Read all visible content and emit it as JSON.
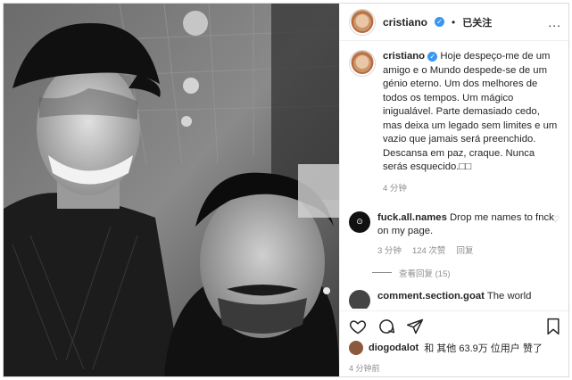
{
  "header": {
    "username": "cristiano",
    "verified_icon": "verified-badge-icon",
    "separator": "•",
    "follow_label": "已关注",
    "more_label": "..."
  },
  "caption": {
    "username": "cristiano",
    "text": "Hoje despeço-me de um amigo e o Mundo despede-se de um génio eterno. Um dos melhores de todos os tempos. Um mágico inigualável. Parte demasiado cedo, mas deixa um legado sem limites e um vazio que jamais será preenchido. Descansa em paz, craque. Nunca serás esquecido.",
    "tail": "□□",
    "time": "4 分钟"
  },
  "comments": [
    {
      "username": "fuck.all.names",
      "text": "Drop me names to fnck on my page.",
      "time": "3 分钟",
      "likes": "124 次赞",
      "reply": "回复",
      "replies": "查看回复 (15)"
    },
    {
      "username": "comment.section.goat",
      "text": "The world"
    }
  ],
  "actions": {
    "icons": [
      "heart-icon",
      "comment-icon",
      "share-icon",
      "bookmark-icon"
    ]
  },
  "likes": {
    "user": "diogodalot",
    "text": "和 其他 63.9万 位用户 赞了"
  },
  "date": "4 分钟前",
  "colors": {
    "verified": "#3897f0",
    "text": "#262626",
    "muted": "#8e8e8e",
    "border": "#dbdbdb"
  }
}
